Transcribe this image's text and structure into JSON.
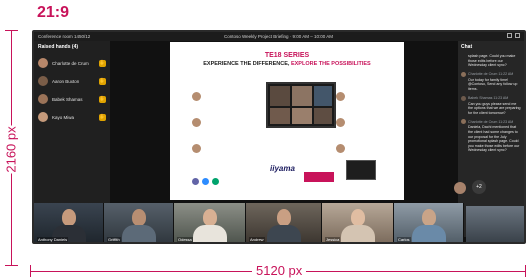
{
  "annotations": {
    "aspect_ratio": "21:9",
    "height_label": "2160 px",
    "width_label": "5120 px"
  },
  "topbar": {
    "room": "Conference room 1450/12",
    "meeting": "Contoso Weekly Project Briefing · 9:00 AM – 10:00 AM"
  },
  "raised_hands": {
    "title": "Raised hands (4)",
    "people": [
      {
        "name": "Charlotte de Crum"
      },
      {
        "name": "Aaron Buxton"
      },
      {
        "name": "Babek Shamas"
      },
      {
        "name": "Kayo Miwa"
      }
    ]
  },
  "presentation": {
    "title": "TE18 SERIES",
    "subtitle_main": "EXPERIENCE THE DIFFERENCE,",
    "subtitle_accent": " EXPLORE THE POSSIBILITIES",
    "brand": "iiyama"
  },
  "chat": {
    "title": "Chat",
    "messages": [
      {
        "sender": "",
        "body": "splash page. Could you make those edits before our Wednesday client sync?"
      },
      {
        "sender": "Charlotte de Crum 11:22 AM",
        "body": "Our today for family time! @Contoso, Send any follow up items."
      },
      {
        "sender": "Babek Shamas 11:23 AM",
        "body": "Can you guys please send me the options that we are preparing for the client tomorrow?"
      },
      {
        "sender": "Charlotte de Crum 11:23 AM",
        "body": "Daniela, Dachi mentioned that the client had some changes to our proposal for the July promotional splash page. Could you make those edits before our Wednesday client sync?"
      }
    ]
  },
  "participants": [
    {
      "name": "Anthony Daniels"
    },
    {
      "name": "Griffith"
    },
    {
      "name": "Odessa"
    },
    {
      "name": "Andrew"
    },
    {
      "name": "Jessica"
    },
    {
      "name": "Carlos"
    }
  ],
  "overflow": {
    "count_label": "+2"
  }
}
